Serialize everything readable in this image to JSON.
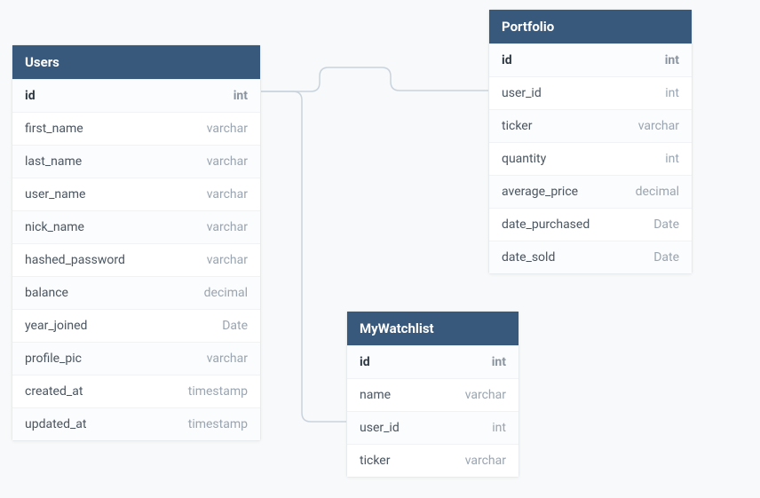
{
  "tables": {
    "users": {
      "title": "Users",
      "columns": [
        {
          "name": "id",
          "type": "int",
          "pk": true
        },
        {
          "name": "first_name",
          "type": "varchar"
        },
        {
          "name": "last_name",
          "type": "varchar"
        },
        {
          "name": "user_name",
          "type": "varchar"
        },
        {
          "name": "nick_name",
          "type": "varchar"
        },
        {
          "name": "hashed_password",
          "type": "varchar"
        },
        {
          "name": "balance",
          "type": "decimal"
        },
        {
          "name": "year_joined",
          "type": "Date"
        },
        {
          "name": "profile_pic",
          "type": "varchar"
        },
        {
          "name": "created_at",
          "type": "timestamp"
        },
        {
          "name": "updated_at",
          "type": "timestamp"
        }
      ]
    },
    "portfolio": {
      "title": "Portfolio",
      "columns": [
        {
          "name": "id",
          "type": "int",
          "pk": true
        },
        {
          "name": "user_id",
          "type": "int"
        },
        {
          "name": "ticker",
          "type": "varchar"
        },
        {
          "name": "quantity",
          "type": "int"
        },
        {
          "name": "average_price",
          "type": "decimal"
        },
        {
          "name": "date_purchased",
          "type": "Date"
        },
        {
          "name": "date_sold",
          "type": "Date"
        }
      ]
    },
    "mywatchlist": {
      "title": "MyWatchlist",
      "columns": [
        {
          "name": "id",
          "type": "int",
          "pk": true
        },
        {
          "name": "name",
          "type": "varchar"
        },
        {
          "name": "user_id",
          "type": "int"
        },
        {
          "name": "ticker",
          "type": "varchar"
        }
      ]
    }
  }
}
